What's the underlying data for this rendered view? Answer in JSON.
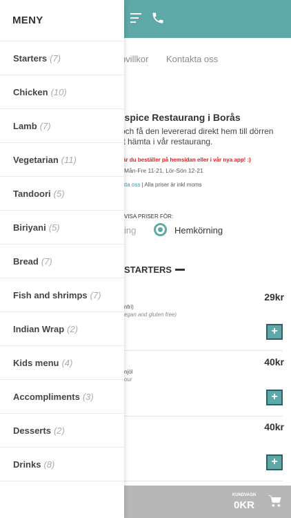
{
  "header": {
    "menu_icon": "hamburger-icon",
    "phone_icon": "phone-icon",
    "bg_color": "#5fa8a8"
  },
  "nav": {
    "link_terms": "pvillkor",
    "link_contact": "Kontakta oss"
  },
  "restaurant": {
    "title": "nspice Restaurang i Borås",
    "subtitle_line1": "och få den levererad direkt hem till dörren",
    "subtitle_line2": "tt hämta i vår restaurang.",
    "promo": "är du beställer på hemsidan eller i vår nya app! :)",
    "hours": "Mån-Fre 11-21, Lör-Sön 12-21",
    "info_link": "kta oss",
    "info_text": " | Alla priser är inkl moms"
  },
  "price_mode": {
    "label": "VISA PRISER FÖR:",
    "option_pickup": "ing",
    "option_delivery": "Hemkörning",
    "selected": "Hemkörning"
  },
  "category": {
    "heading": "STARTERS",
    "collapse_icon": "minus-icon"
  },
  "items": [
    {
      "price": "29kr",
      "desc1": "nfri)",
      "desc2": "egan and gluten free)",
      "add_label": "+"
    },
    {
      "price": "40kr",
      "desc1": "njöl",
      "desc2": "our",
      "add_label": "+"
    },
    {
      "price": "40kr",
      "desc1": "",
      "desc2": "",
      "add_label": "+"
    }
  ],
  "cart": {
    "label": "KUNDVAGN",
    "total": "0KR",
    "icon": "cart-icon"
  },
  "side_menu": {
    "title": "MENY",
    "items": [
      {
        "label": "Starters",
        "count": "(7)"
      },
      {
        "label": "Chicken",
        "count": "(10)"
      },
      {
        "label": "Lamb",
        "count": "(7)"
      },
      {
        "label": "Vegetarian",
        "count": "(11)"
      },
      {
        "label": "Tandoori",
        "count": "(5)"
      },
      {
        "label": "Biriyani",
        "count": "(5)"
      },
      {
        "label": "Bread",
        "count": "(7)"
      },
      {
        "label": "Fish and shrimps",
        "count": "(7)"
      },
      {
        "label": "Indian Wrap",
        "count": "(2)"
      },
      {
        "label": "Kids menu",
        "count": "(4)"
      },
      {
        "label": "Accompliments",
        "count": "(3)"
      },
      {
        "label": "Desserts",
        "count": "(2)"
      },
      {
        "label": "Drinks",
        "count": "(8)"
      }
    ]
  }
}
